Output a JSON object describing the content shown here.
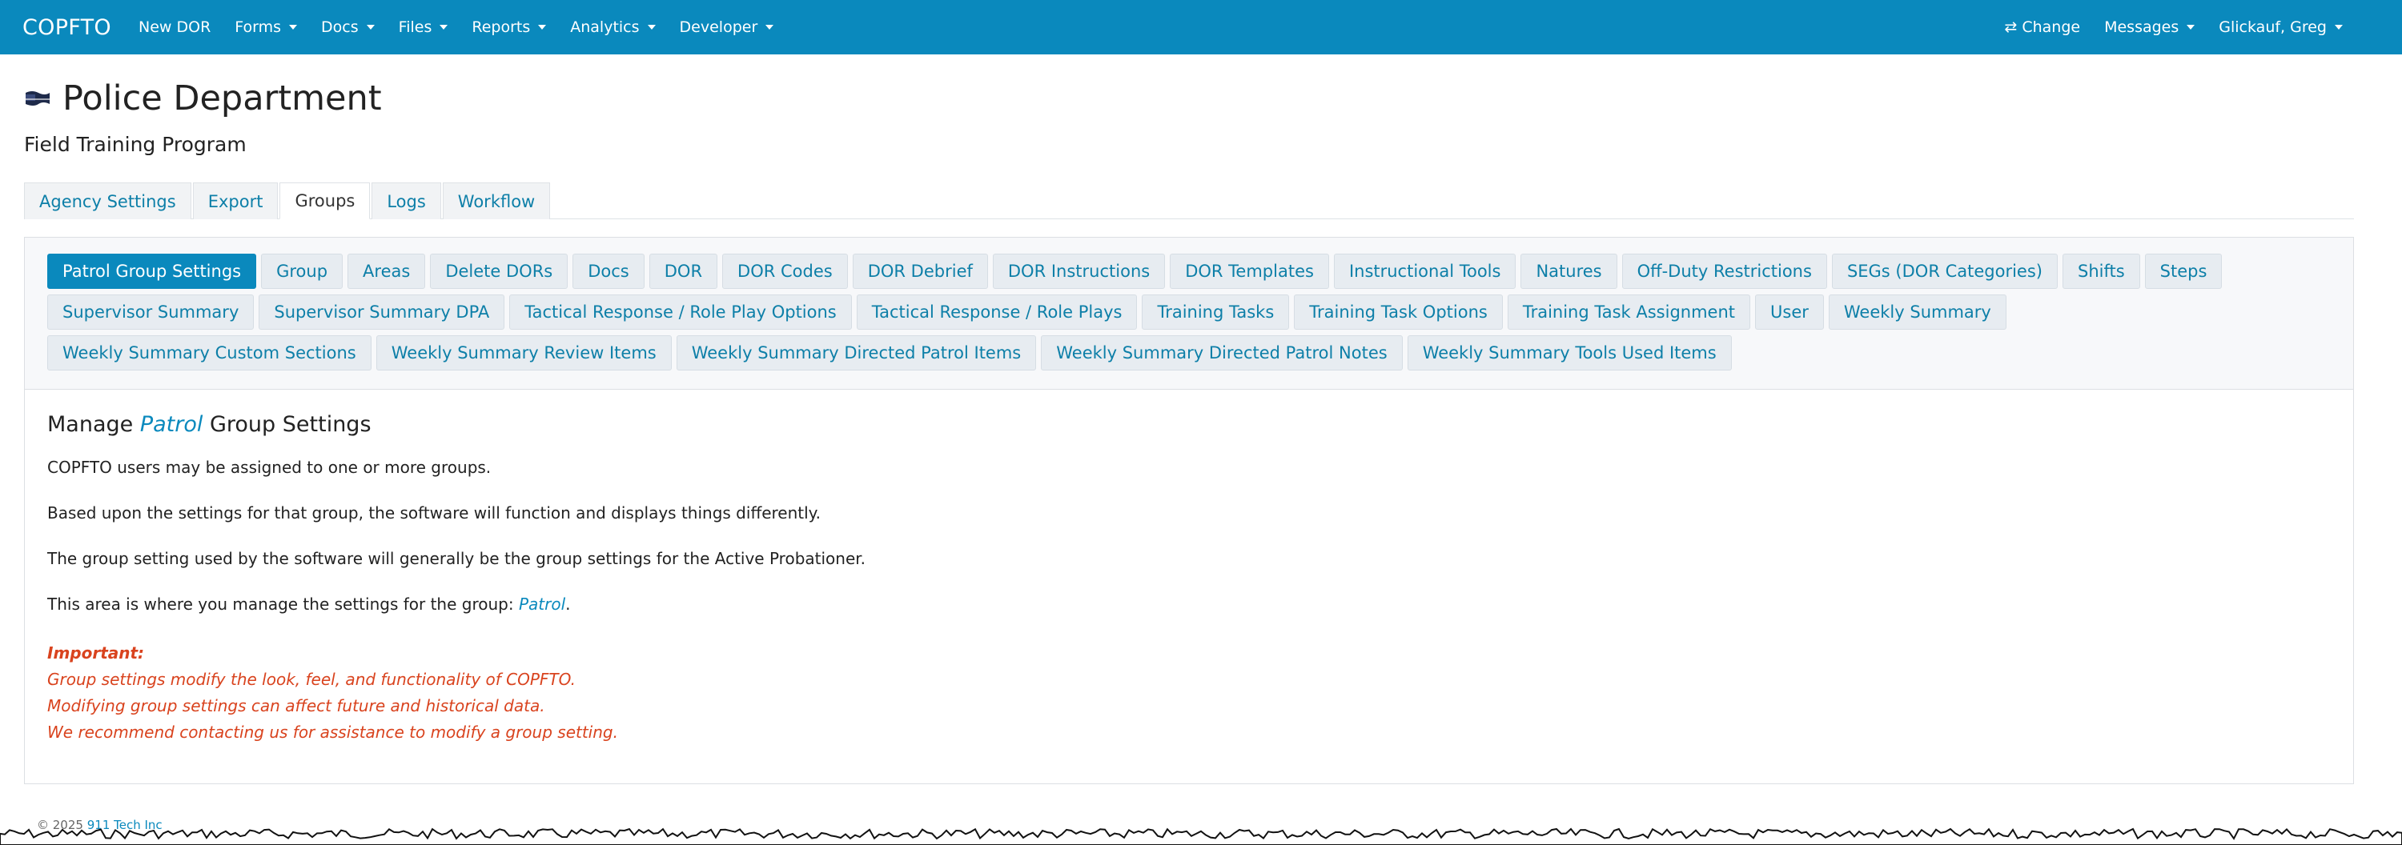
{
  "navbar": {
    "brand": "COPFTO",
    "left_items": [
      {
        "label": "New DOR",
        "dropdown": false
      },
      {
        "label": "Forms",
        "dropdown": true
      },
      {
        "label": "Docs",
        "dropdown": true
      },
      {
        "label": "Files",
        "dropdown": true
      },
      {
        "label": "Reports",
        "dropdown": true
      },
      {
        "label": "Analytics",
        "dropdown": true
      },
      {
        "label": "Developer",
        "dropdown": true
      }
    ],
    "right_items": {
      "change": "⇄ Change",
      "messages": "Messages",
      "user": "Glickauf, Greg"
    },
    "color": "#0a89bd"
  },
  "header": {
    "title": "Police Department",
    "subtitle": "Field Training Program"
  },
  "top_tabs": [
    {
      "label": "Agency Settings",
      "active": false
    },
    {
      "label": "Export",
      "active": false
    },
    {
      "label": "Groups",
      "active": true
    },
    {
      "label": "Logs",
      "active": false
    },
    {
      "label": "Workflow",
      "active": false
    }
  ],
  "pills": [
    {
      "label": "Patrol Group Settings",
      "active": true
    },
    {
      "label": "Group"
    },
    {
      "label": "Areas"
    },
    {
      "label": "Delete DORs"
    },
    {
      "label": "Docs"
    },
    {
      "label": "DOR"
    },
    {
      "label": "DOR Codes"
    },
    {
      "label": "DOR Debrief"
    },
    {
      "label": "DOR Instructions"
    },
    {
      "label": "DOR Templates"
    },
    {
      "label": "Instructional Tools"
    },
    {
      "label": "Natures"
    },
    {
      "label": "Off-Duty Restrictions"
    },
    {
      "label": "SEGs (DOR Categories)"
    },
    {
      "label": "Shifts"
    },
    {
      "label": "Steps"
    },
    {
      "label": "Supervisor Summary"
    },
    {
      "label": "Supervisor Summary DPA"
    },
    {
      "label": "Tactical Response / Role Play Options"
    },
    {
      "label": "Tactical Response / Role Plays"
    },
    {
      "label": "Training Tasks"
    },
    {
      "label": "Training Task Options"
    },
    {
      "label": "Training Task Assignment"
    },
    {
      "label": "User"
    },
    {
      "label": "Weekly Summary"
    },
    {
      "label": "Weekly Summary Custom Sections"
    },
    {
      "label": "Weekly Summary Review Items"
    },
    {
      "label": "Weekly Summary Directed Patrol Items"
    },
    {
      "label": "Weekly Summary Directed Patrol Notes"
    },
    {
      "label": "Weekly Summary Tools Used Items"
    }
  ],
  "content": {
    "title_prefix": "Manage",
    "title_group": "Patrol",
    "title_suffix": "Group Settings",
    "para1": "COPFTO users may be assigned to one or more groups.",
    "para2": "Based upon the settings for that group, the software will function and displays things differently.",
    "para3": "The group setting used by the software will generally be the group settings for the Active Probationer.",
    "para4_prefix": "This area is where you manage the settings for the group:",
    "para4_group": "Patrol",
    "para4_suffix": ".",
    "important_label": "Important:",
    "important_lines": [
      "Group settings modify the look, feel, and functionality of COPFTO.",
      "Modifying group settings can affect future and historical data.",
      "We recommend contacting us for assistance to modify a group setting."
    ],
    "warning_color": "#d9431e"
  },
  "footer": {
    "copyright": "© 2025",
    "company": "911 Tech Inc"
  }
}
